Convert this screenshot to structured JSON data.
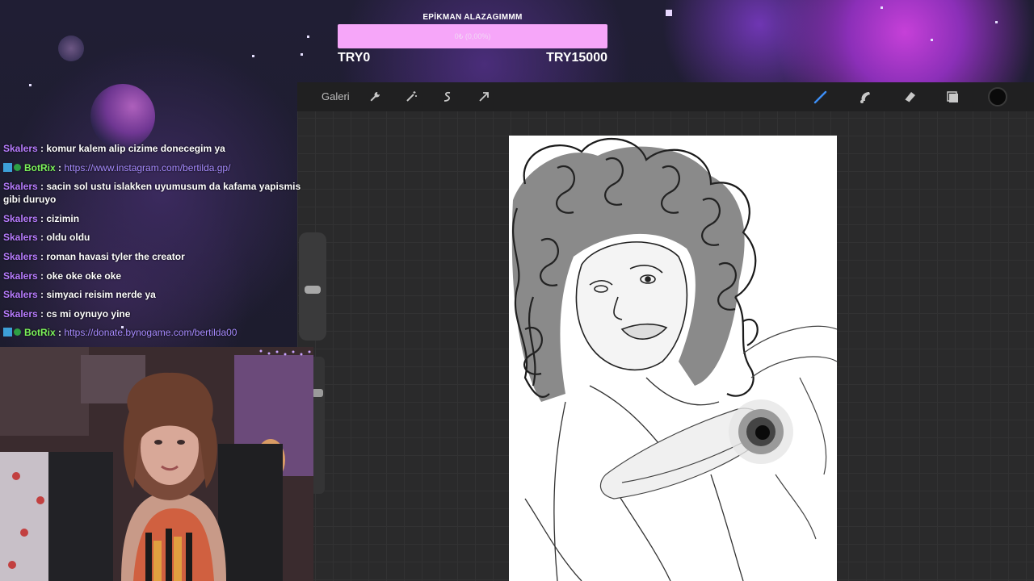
{
  "goal": {
    "title": "EPİKMAN ALAZAGIMMM",
    "progress_text": "0₺ (0,00%)",
    "progress_fraction": 0.0,
    "min_label": "TRY0",
    "max_label": "TRY15000"
  },
  "toolbar": {
    "gallery_label": "Galeri",
    "left_tools": [
      "wrench-icon",
      "magic-wand-icon",
      "selection-icon",
      "transform-arrow-icon"
    ],
    "right_tools": [
      "brush-icon",
      "smudge-icon",
      "eraser-icon",
      "layers-icon"
    ],
    "active_tool": "brush-icon",
    "active_color": "#0a0a0a"
  },
  "chat": {
    "messages": [
      {
        "user": "Skalers",
        "text": "komur kalem alip cizime donecegim ya",
        "is_link": false,
        "badges": false
      },
      {
        "user": "BotRix",
        "text": "https://www.instagram.com/bertilda.gp/",
        "is_link": true,
        "badges": true
      },
      {
        "user": "Skalers",
        "text": "sacin sol ustu islakken uyumusum da kafama yapismis gibi duruyo",
        "is_link": false,
        "badges": false
      },
      {
        "user": "Skalers",
        "text": "cizimin",
        "is_link": false,
        "badges": false
      },
      {
        "user": "Skalers",
        "text": "oldu oldu",
        "is_link": false,
        "badges": false
      },
      {
        "user": "Skalers",
        "text": "roman havasi tyler the creator",
        "is_link": false,
        "badges": false
      },
      {
        "user": "Skalers",
        "text": "oke oke oke oke",
        "is_link": false,
        "badges": false
      },
      {
        "user": "Skalers",
        "text": "simyaci reisim nerde ya",
        "is_link": false,
        "badges": false
      },
      {
        "user": "Skalers",
        "text": "cs mi oynuyo yine",
        "is_link": false,
        "badges": false
      },
      {
        "user": "BotRix",
        "text": "https://donate.bynogame.com/bertilda00",
        "is_link": true,
        "badges": true
      }
    ]
  },
  "colors": {
    "goal_bar": "#f6a6f9",
    "skalers": "#b87cff",
    "botrix": "#7cf35a",
    "link": "#a78bff",
    "active_tool": "#3d8ef5"
  }
}
